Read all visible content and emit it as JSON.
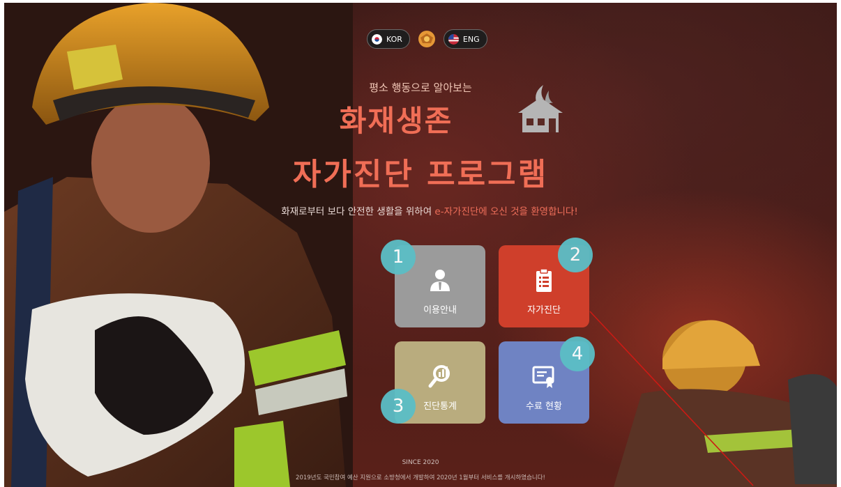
{
  "language": {
    "kor_label": "KOR",
    "eng_label": "ENG"
  },
  "hero": {
    "subtitle": "평소 행동으로 알아보는",
    "title_line1": "화재생존",
    "title_line2": "자가진단 프로그램",
    "welcome_prefix": "화재로부터 보다 안전한 생활을 위하여 ",
    "welcome_highlight": "e-자가진단에 오신 것을 환영합니다!"
  },
  "menu": {
    "items": [
      {
        "number": "1",
        "label": "이용안내",
        "color": "#9b9b9b",
        "icon": "user-guide-icon"
      },
      {
        "number": "2",
        "label": "자가진단",
        "color": "#cf3f2b",
        "icon": "clipboard-icon"
      },
      {
        "number": "3",
        "label": "진단통계",
        "color": "#b9ac7e",
        "icon": "statistics-magnifier-icon"
      },
      {
        "number": "4",
        "label": "수료 현황",
        "color": "#6f83c3",
        "icon": "certificate-icon"
      }
    ]
  },
  "footer": {
    "since": "SINCE 2020",
    "notice": "2019년도 국민참여 예산 지원으로 소방청에서 개발하여 2020년 1월부터 서비스를 개시하였습니다!"
  },
  "colors": {
    "accent_red": "#f06e56",
    "badge_teal": "#5bbec6"
  }
}
